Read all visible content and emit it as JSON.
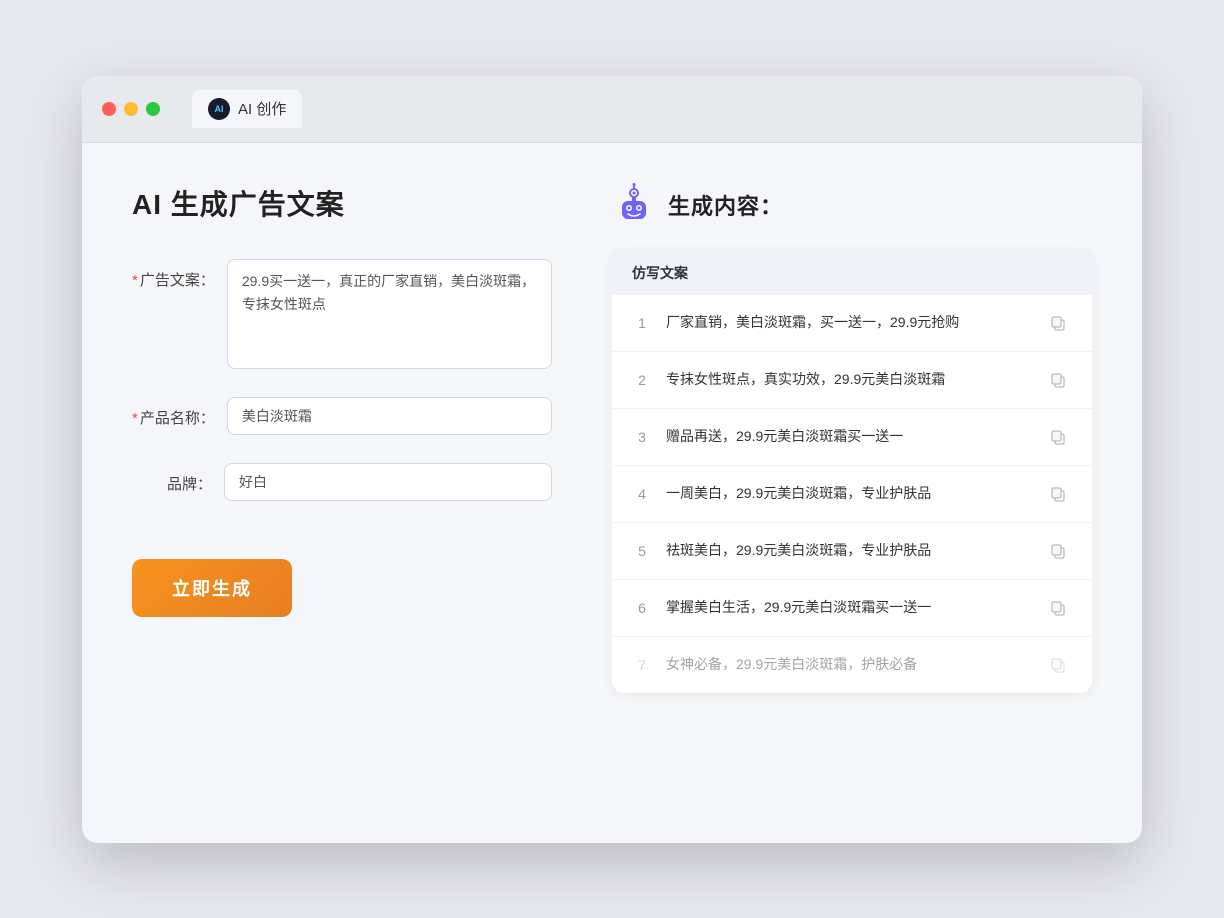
{
  "browser": {
    "tab_label": "AI 创作",
    "tab_icon_text": "AI"
  },
  "left_panel": {
    "title": "AI 生成广告文案",
    "form": {
      "ad_copy_label": "广告文案：",
      "ad_copy_required": true,
      "ad_copy_value": "29.9买一送一，真正的厂家直销，美白淡斑霜，专抹女性斑点",
      "product_name_label": "产品名称：",
      "product_name_required": true,
      "product_name_value": "美白淡斑霜",
      "brand_label": "品牌：",
      "brand_required": false,
      "brand_value": "好白"
    },
    "generate_button": "立即生成"
  },
  "right_panel": {
    "title": "生成内容：",
    "table_header": "仿写文案",
    "results": [
      {
        "id": 1,
        "text": "厂家直销，美白淡斑霜，买一送一，29.9元抢购",
        "dimmed": false
      },
      {
        "id": 2,
        "text": "专抹女性斑点，真实功效，29.9元美白淡斑霜",
        "dimmed": false
      },
      {
        "id": 3,
        "text": "赠品再送，29.9元美白淡斑霜买一送一",
        "dimmed": false
      },
      {
        "id": 4,
        "text": "一周美白，29.9元美白淡斑霜，专业护肤品",
        "dimmed": false
      },
      {
        "id": 5,
        "text": "祛斑美白，29.9元美白淡斑霜，专业护肤品",
        "dimmed": false
      },
      {
        "id": 6,
        "text": "掌握美白生活，29.9元美白淡斑霜买一送一",
        "dimmed": false
      },
      {
        "id": 7,
        "text": "女神必备，29.9元美白淡斑霜，护肤必备",
        "dimmed": true
      }
    ]
  }
}
